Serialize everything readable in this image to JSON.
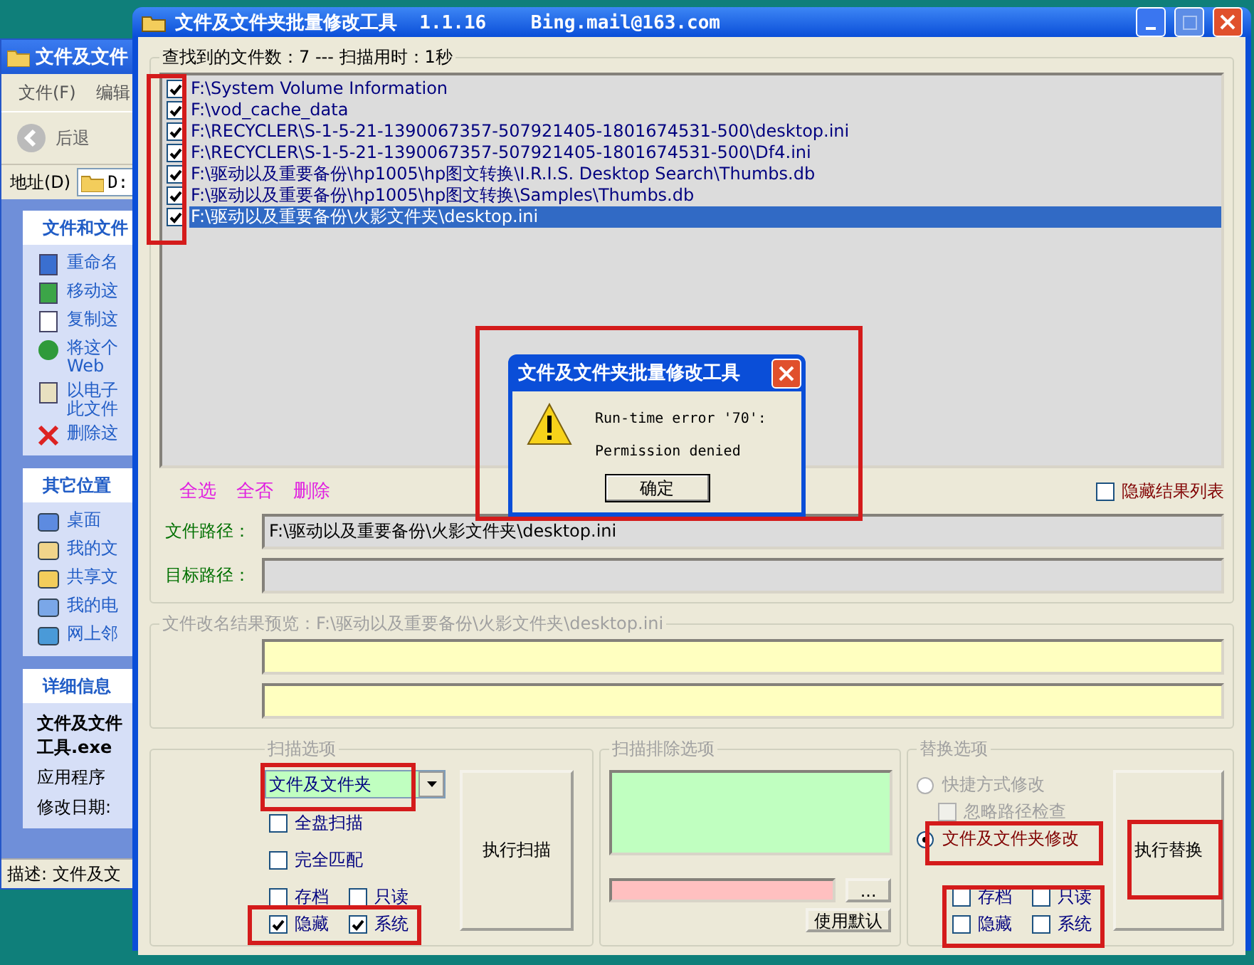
{
  "explorer": {
    "title": "文件及文件",
    "menu": [
      "文件(F)",
      "编辑"
    ],
    "back_label": "后退",
    "address_label": "地址(D)",
    "address_value": "D:",
    "tasks": {
      "title": "文件和文件",
      "items": [
        [
          "重命名"
        ],
        [
          "移动这"
        ],
        [
          "复制这"
        ],
        [
          "将这个",
          "Web"
        ],
        [
          "以电子",
          "此文件"
        ],
        [
          "删除这"
        ]
      ]
    },
    "places": {
      "title": "其它位置",
      "items": [
        "桌面",
        "我的文",
        "共享文",
        "我的电",
        "网上邻"
      ]
    },
    "details": {
      "title": "详细信息",
      "name": [
        "文件及文件",
        "工具.exe"
      ],
      "type": "应用程序",
      "modified": "修改日期:"
    },
    "status": "描述: 文件及文"
  },
  "window": {
    "title": "文件及文件夹批量修改工具  1.1.16    Bing.mail@163.com"
  },
  "results": {
    "legend": "查找到的文件数：7 --- 扫描用时：1秒",
    "items": [
      {
        "path": "F:\\System Volume Information",
        "checked": true,
        "selected": false
      },
      {
        "path": "F:\\vod_cache_data",
        "checked": true,
        "selected": false
      },
      {
        "path": "F:\\RECYCLER\\S-1-5-21-1390067357-507921405-1801674531-500\\desktop.ini",
        "checked": true,
        "selected": false
      },
      {
        "path": "F:\\RECYCLER\\S-1-5-21-1390067357-507921405-1801674531-500\\Df4.ini",
        "checked": true,
        "selected": false
      },
      {
        "path": "F:\\驱动以及重要备份\\hp1005\\hp图文转换\\I.R.I.S. Desktop Search\\Thumbs.db",
        "checked": true,
        "selected": false
      },
      {
        "path": "F:\\驱动以及重要备份\\hp1005\\hp图文转换\\Samples\\Thumbs.db",
        "checked": true,
        "selected": false
      },
      {
        "path": "F:\\驱动以及重要备份\\火影文件夹\\desktop.ini",
        "checked": true,
        "selected": true
      }
    ]
  },
  "actions": [
    "全选",
    "全否",
    "删除"
  ],
  "hide_results": {
    "label": "隐藏结果列表",
    "checked": false
  },
  "file_path": {
    "label": "文件路径：",
    "value": "F:\\驱动以及重要备份\\火影文件夹\\desktop.ini"
  },
  "target_path": {
    "label": "目标路径："
  },
  "preview": {
    "legend": "文件改名结果预览：F:\\驱动以及重要备份\\火影文件夹\\desktop.ini"
  },
  "scan_options": {
    "legend": "扫描选项",
    "mode": "文件及文件夹",
    "checks": [
      {
        "label": "全盘扫描",
        "checked": false
      },
      {
        "label": "完全匹配",
        "checked": false
      }
    ],
    "attrs": [
      {
        "label": "存档",
        "checked": false
      },
      {
        "label": "只读",
        "checked": false
      },
      {
        "label": "隐藏",
        "checked": true
      },
      {
        "label": "系统",
        "checked": true
      }
    ],
    "button": "执行扫描"
  },
  "exclude": {
    "legend": "扫描排除选项",
    "browse": "...",
    "default_button": "使用默认"
  },
  "replace": {
    "legend": "替换选项",
    "modes": [
      {
        "label": "快捷方式修改",
        "selected": false,
        "disabled": true
      },
      {
        "label": "文件及文件夹修改",
        "selected": true,
        "disabled": false
      }
    ],
    "ignore_path": {
      "label": "忽略路径检查",
      "checked": false,
      "disabled": true
    },
    "attrs": [
      {
        "label": "存档",
        "checked": false
      },
      {
        "label": "只读",
        "checked": false
      },
      {
        "label": "隐藏",
        "checked": false
      },
      {
        "label": "系统",
        "checked": false
      }
    ],
    "button": "执行替换"
  },
  "dialog": {
    "title": "文件及文件夹批量修改工具",
    "lines": [
      "Run-time error '70':",
      "Permission denied"
    ],
    "ok": "确定"
  }
}
